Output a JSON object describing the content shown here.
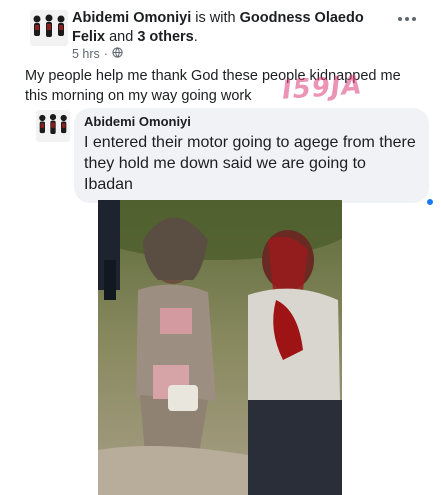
{
  "post": {
    "author": "Abidemi Omoniyi",
    "with_text": "is with",
    "tagged": "Goodness Olaedo Felix",
    "and_text": "and",
    "others": "3 others",
    "period": ".",
    "time": "5 hrs",
    "audience_icon": "globe-icon",
    "text": "My people help me thank God these people kidnapped me this morning on my way going work"
  },
  "watermark": {
    "text": "I59JA"
  },
  "comment": {
    "author": "Abidemi Omoniyi",
    "text": "I entered their motor going to agege from there they hold me down said we are going to Ibadan"
  },
  "colors": {
    "text": "#1c1e21",
    "meta": "#606770",
    "bubble": "#f0f2f5",
    "accent": "#1877f2"
  }
}
